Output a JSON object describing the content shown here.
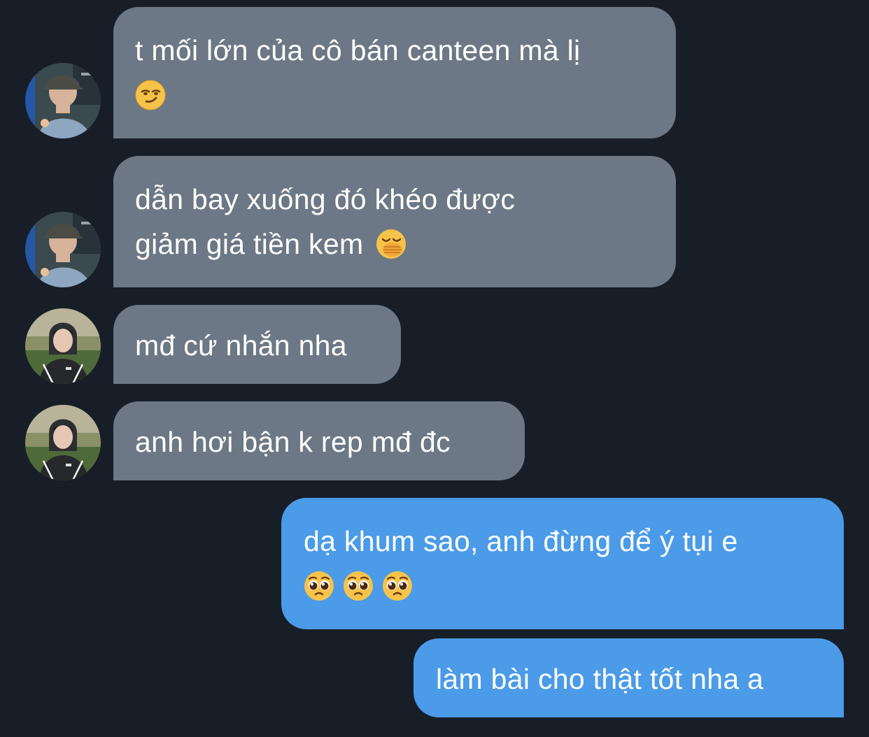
{
  "messages": [
    {
      "direction": "incoming",
      "sender_avatar": "bucket-hat-avatar",
      "lines": [
        "t mối lớn của cô bán canteen mà lị"
      ],
      "emojis": [
        "smirk-emoji"
      ]
    },
    {
      "direction": "incoming",
      "sender_avatar": "bucket-hat-avatar",
      "lines": [
        "dẫn bay xuống đó khéo được",
        "giảm giá tiền kem"
      ],
      "emojis": [
        "hand-over-mouth-emoji"
      ]
    },
    {
      "direction": "incoming",
      "sender_avatar": "hoodie-avatar",
      "lines": [
        "mđ cứ nhắn nha"
      ],
      "emojis": []
    },
    {
      "direction": "incoming",
      "sender_avatar": "hoodie-avatar",
      "lines": [
        "anh hơi bận k rep mđ đc"
      ],
      "emojis": []
    },
    {
      "direction": "outgoing",
      "lines": [
        "dạ khum sao, anh đừng để ý tụi e"
      ],
      "emojis": [
        "pleading-face-emoji",
        "pleading-face-emoji",
        "pleading-face-emoji"
      ]
    },
    {
      "direction": "outgoing",
      "lines": [
        "làm bài cho thật tốt nha a"
      ],
      "emojis": []
    }
  ],
  "colors": {
    "background": "#171e28",
    "incoming_bubble": "#6c7885",
    "outgoing_bubble": "#4b9be8",
    "text": "#ffffff"
  }
}
